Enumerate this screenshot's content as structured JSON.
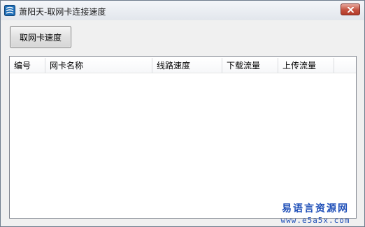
{
  "window": {
    "title": "萧阳天-取网卡连接速度",
    "app_icon": "app-logo-icon",
    "close_icon": "close-icon",
    "accent_close": "#c4513f"
  },
  "toolbar": {
    "get_speed_label": "取网卡速度"
  },
  "listview": {
    "columns": [
      "编号",
      "网卡名称",
      "线路速度",
      "下载流量",
      "上传流量"
    ],
    "rows": []
  },
  "watermark": {
    "brand": "易语言资源网",
    "url": "www.e5a5x.com",
    "color": "#1f4fb8"
  }
}
